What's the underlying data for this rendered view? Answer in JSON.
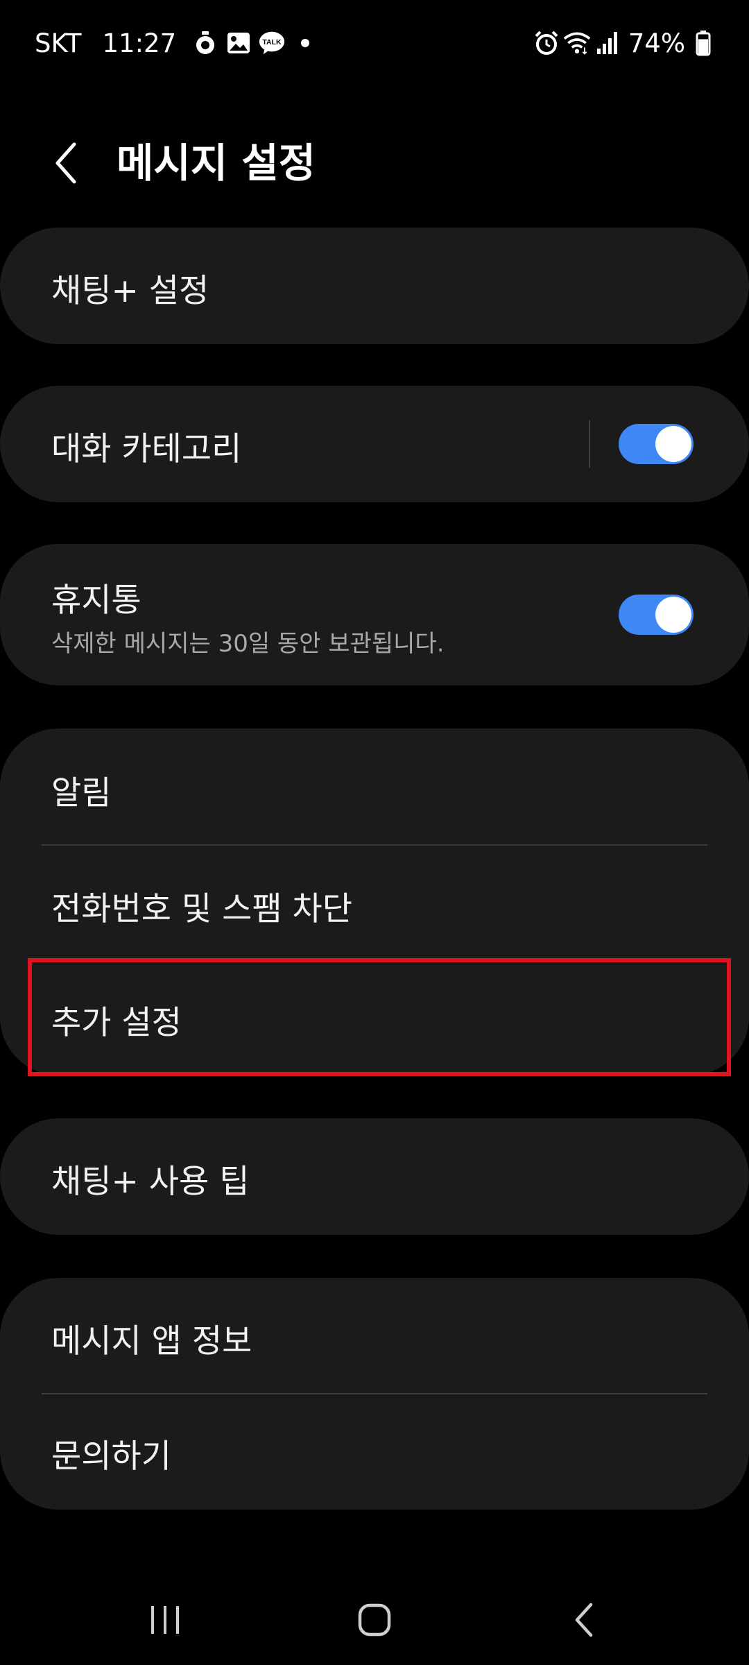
{
  "status_bar": {
    "carrier": "SKT",
    "time": "11:27",
    "notification_icons": [
      "timer-icon",
      "gallery-icon",
      "kakaotalk-icon",
      "dot-icon"
    ],
    "talk_icon_text": "TALK",
    "right_icons": [
      "alarm-icon",
      "wifi-icon",
      "signal-icon",
      "battery-icon"
    ],
    "battery_percent": "74%",
    "battery_level": 0.74
  },
  "header": {
    "title": "메시지 설정"
  },
  "cards": {
    "chat_plus_settings": {
      "label": "채팅+ 설정"
    },
    "conversation_category": {
      "label": "대화 카테고리",
      "toggle_on": true
    },
    "trash": {
      "label": "휴지통",
      "subtitle": "삭제한 메시지는 30일 동안 보관됩니다.",
      "toggle_on": true
    },
    "group_settings": {
      "notifications": "알림",
      "block_numbers": "전화번호 및 스팸 차단",
      "more_settings": "추가 설정"
    },
    "chat_plus_tips": {
      "label": "채팅+ 사용 팁"
    },
    "about_group": {
      "app_info": "메시지 앱 정보",
      "contact_us": "문의하기"
    }
  },
  "colors": {
    "background": "#000000",
    "card": "#1b1b1b",
    "toggle_on": "#3f87f5",
    "highlight": "#e0141f"
  },
  "nav_bar": {
    "buttons": [
      "recent-apps-icon",
      "home-icon",
      "back-icon"
    ]
  }
}
